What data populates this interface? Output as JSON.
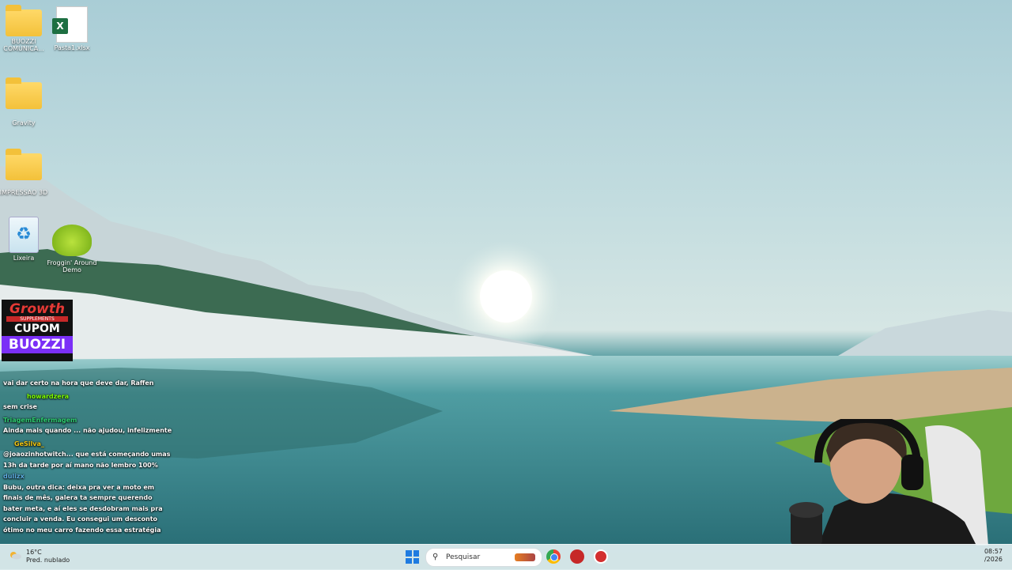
{
  "desktop": {
    "icons": [
      {
        "label": "BUOZZI\nCOMUNICA...",
        "icon": "folder-icon"
      },
      {
        "label": "Pasta1.xlsx",
        "icon": "excel-file-icon"
      },
      {
        "label": "Gravity",
        "icon": "folder-icon"
      },
      {
        "label": "IMPRESSAO 3D",
        "icon": "folder-icon"
      },
      {
        "label": "Lixeira",
        "icon": "recycle-bin-icon"
      },
      {
        "label": "Froggin' Around\nDemo",
        "icon": "frog-game-icon"
      }
    ]
  },
  "promo": {
    "brand": "Growth",
    "tagline": "SUPPLEMENTS",
    "cupom": "CUPOM",
    "code": "BUOZZI"
  },
  "chat": {
    "messages": [
      {
        "user": "",
        "text": "vai dar certo na hora que deve dar, Raffen"
      },
      {
        "user": "howardzera",
        "user_color": "#7CFC00",
        "text": "sem crise"
      },
      {
        "user": "TriagemEnfermagem",
        "user_color": "#2ecc71",
        "text": "Ainda mais quando ... não ajudou, infelizmente"
      },
      {
        "user": "GeSilva_",
        "user_color": "#f1c40f",
        "text": "@joaozinhotwitch... que está começando umas 13h da tarde por aí mano não lembro 100%"
      },
      {
        "user": "dulizx",
        "user_color": "#5dade2",
        "text": "Bubu, outra dica: deixa pra ver a moto em finais de mês, galera ta sempre querendo bater meta, e aí eles se desdobram mais pra concluir a venda. Eu consegui um desconto ótimo no meu carro fazendo essa estratégia"
      }
    ]
  },
  "taskbar": {
    "weather_temp": "16°C",
    "weather_desc": "Pred. nublado",
    "search_placeholder": "Pesquisar",
    "apps": [
      "chrome-icon",
      "app-red-icon",
      "app-red-icon-2"
    ],
    "time": "08:57",
    "date": "/2026",
    "start_color": "#1f7be0"
  }
}
